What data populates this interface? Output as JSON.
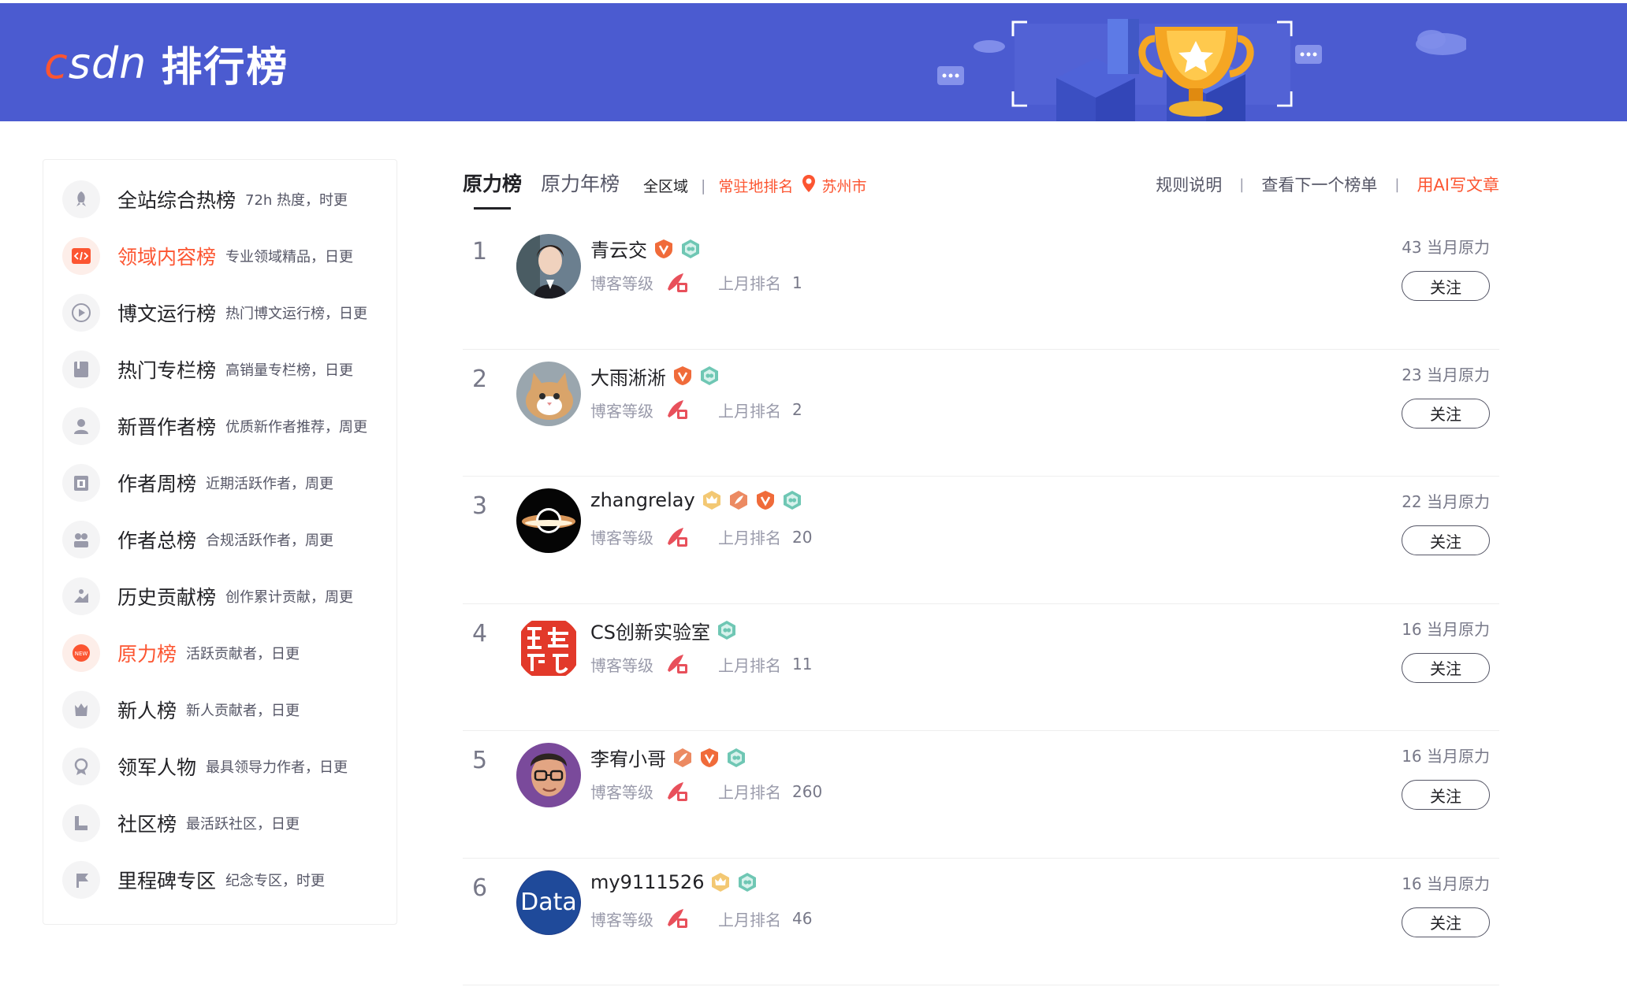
{
  "header": {
    "logo_text_c": "c",
    "logo_text_rest": "sdn",
    "title": "排行榜"
  },
  "colors": {
    "brand": "#fc5531",
    "banner": "#4b5bd0"
  },
  "sidebar": {
    "items": [
      {
        "label": "全站综合热榜",
        "desc": "72h 热度，时更",
        "icon": "rocket-icon",
        "active": false
      },
      {
        "label": "领域内容榜",
        "desc": "专业领域精品，日更",
        "icon": "code-icon",
        "active": true
      },
      {
        "label": "博文运行榜",
        "desc": "热门博文运行榜，日更",
        "icon": "play-icon",
        "active": false
      },
      {
        "label": "热门专栏榜",
        "desc": "高销量专栏榜，日更",
        "icon": "book-icon",
        "active": false
      },
      {
        "label": "新晋作者榜",
        "desc": "优质新作者推荐，周更",
        "icon": "user-icon",
        "active": false
      },
      {
        "label": "作者周榜",
        "desc": "近期活跃作者，周更",
        "icon": "calendar-icon",
        "active": false
      },
      {
        "label": "作者总榜",
        "desc": "合规活跃作者，周更",
        "icon": "group-icon",
        "active": false
      },
      {
        "label": "历史贡献榜",
        "desc": "创作累计贡献，周更",
        "icon": "hand-icon",
        "active": false
      },
      {
        "label": "原力榜",
        "desc": "活跃贡献者，日更",
        "icon": "new-icon",
        "active": true
      },
      {
        "label": "新人榜",
        "desc": "新人贡献者，日更",
        "icon": "newbie-icon",
        "active": false
      },
      {
        "label": "领军人物",
        "desc": "最具领导力作者，日更",
        "icon": "medal-icon",
        "active": false
      },
      {
        "label": "社区榜",
        "desc": "最活跃社区，日更",
        "icon": "flag-icon",
        "active": false
      },
      {
        "label": "里程碑专区",
        "desc": "纪念专区，时更",
        "icon": "milestone-icon",
        "active": false
      }
    ]
  },
  "tabs": [
    {
      "label": "原力榜",
      "active": true
    },
    {
      "label": "原力年榜",
      "active": false
    }
  ],
  "region": {
    "all": "全区域",
    "sep": "|",
    "resident": "常驻地排名",
    "city": "苏州市"
  },
  "toplinks": {
    "rules": "规则说明",
    "next": "查看下一个榜单",
    "ai": "用AI写文章",
    "sep": "|"
  },
  "list": {
    "level_label": "博客等级",
    "prev_label": "上月排名",
    "follow_label": "关注",
    "rows": [
      {
        "rank": "1",
        "name": "青云交",
        "prev": "1",
        "power": "43 当月原力",
        "badges": [
          "v-badge-icon",
          "teal-badge-icon"
        ],
        "avatar": "portrait"
      },
      {
        "rank": "2",
        "name": "大雨淅淅",
        "prev": "2",
        "power": "23 当月原力",
        "badges": [
          "v-badge-icon",
          "teal-badge-icon"
        ],
        "avatar": "cat"
      },
      {
        "rank": "3",
        "name": "zhangrelay",
        "prev": "20",
        "power": "22 当月原力",
        "badges": [
          "crown-badge-icon",
          "feather-badge-icon",
          "v-badge-icon",
          "teal-badge-icon"
        ],
        "avatar": "blackhole"
      },
      {
        "rank": "4",
        "name": "CS创新实验室",
        "prev": "11",
        "power": "16 当月原力",
        "badges": [
          "teal-badge-icon"
        ],
        "avatar": "red-seal"
      },
      {
        "rank": "5",
        "name": "李宥小哥",
        "prev": "260",
        "power": "16 当月原力",
        "badges": [
          "feather-badge-icon",
          "v-badge-icon",
          "teal-badge-icon"
        ],
        "avatar": "glasses"
      },
      {
        "rank": "6",
        "name": "my9111526",
        "prev": "46",
        "power": "16 当月原力",
        "badges": [
          "crown-badge-icon",
          "teal-badge-icon"
        ],
        "avatar": "data",
        "avatar_text": "Data"
      }
    ]
  }
}
